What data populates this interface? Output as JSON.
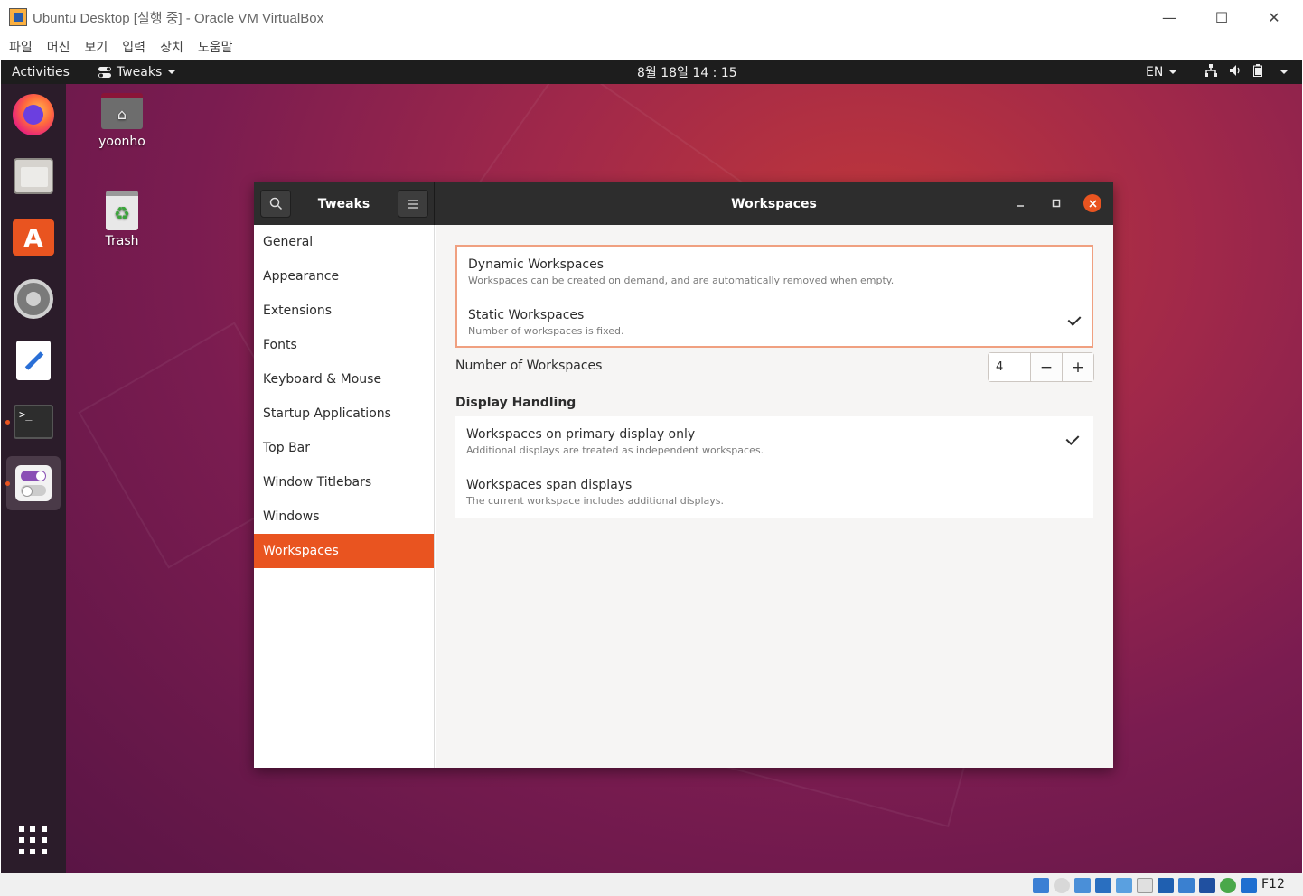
{
  "vbox": {
    "title": "Ubuntu Desktop [실행 중] - Oracle VM VirtualBox",
    "minimize": "—",
    "maximize": "☐",
    "close": "✕",
    "menus": [
      "파일",
      "머신",
      "보기",
      "입력",
      "장치",
      "도움말"
    ],
    "host_key": "F12"
  },
  "topbar": {
    "activities": "Activities",
    "app_menu": "Tweaks",
    "clock": "8월 18일  14 : 15",
    "language": "EN"
  },
  "desktop": {
    "icons": [
      {
        "label": "yoonho"
      },
      {
        "label": "Trash"
      }
    ]
  },
  "tweaks": {
    "sidebar_title": "Tweaks",
    "page_title": "Workspaces",
    "sidebar_items": [
      {
        "label": "General",
        "selected": false
      },
      {
        "label": "Appearance",
        "selected": false
      },
      {
        "label": "Extensions",
        "selected": false
      },
      {
        "label": "Fonts",
        "selected": false
      },
      {
        "label": "Keyboard & Mouse",
        "selected": false
      },
      {
        "label": "Startup Applications",
        "selected": false
      },
      {
        "label": "Top Bar",
        "selected": false
      },
      {
        "label": "Window Titlebars",
        "selected": false
      },
      {
        "label": "Windows",
        "selected": false
      },
      {
        "label": "Workspaces",
        "selected": true
      }
    ],
    "workspace_mode": [
      {
        "title": "Dynamic Workspaces",
        "subtitle": "Workspaces can be created on demand, and are automatically removed when empty.",
        "checked": false
      },
      {
        "title": "Static Workspaces",
        "subtitle": "Number of workspaces is fixed.",
        "checked": true
      }
    ],
    "number_of_workspaces_label": "Number of Workspaces",
    "number_of_workspaces_value": "4",
    "decrement_label": "−",
    "increment_label": "+",
    "display_handling_heading": "Display Handling",
    "display_handling": [
      {
        "title": "Workspaces on primary display only",
        "subtitle": "Additional displays are treated as independent workspaces.",
        "checked": true
      },
      {
        "title": "Workspaces span displays",
        "subtitle": "The current workspace includes additional displays.",
        "checked": false
      }
    ]
  },
  "colors": {
    "accent": "#e95420",
    "header_bar": "#2d2d2d",
    "topbar": "#1d1d1d",
    "dock": "#2b1c2a"
  }
}
